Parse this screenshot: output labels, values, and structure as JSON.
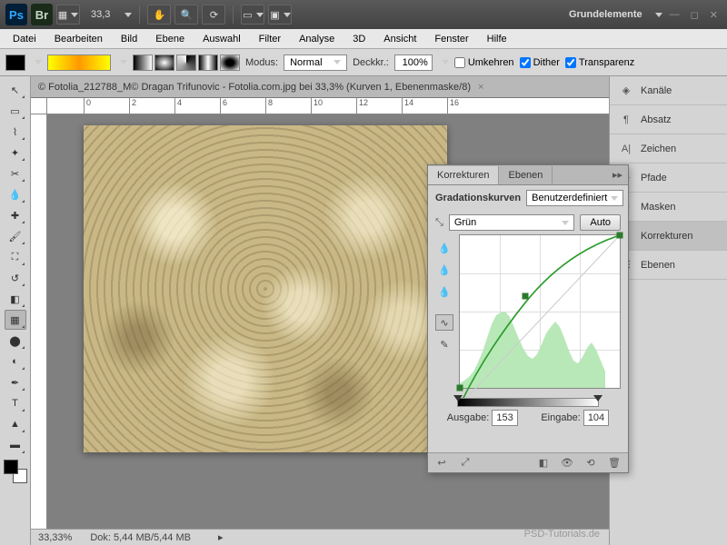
{
  "topbar": {
    "zoom": "33,3",
    "workspace_label": "Grundelemente"
  },
  "menu": [
    "Datei",
    "Bearbeiten",
    "Bild",
    "Ebene",
    "Auswahl",
    "Filter",
    "Analyse",
    "3D",
    "Ansicht",
    "Fenster",
    "Hilfe"
  ],
  "optbar": {
    "modus_label": "Modus:",
    "modus_value": "Normal",
    "deckkr_label": "Deckkr.:",
    "deckkr_value": "100%",
    "umkehren": "Umkehren",
    "dither": "Dither",
    "transparenz": "Transparenz"
  },
  "doc_tab": "© Fotolia_212788_M© Dragan Trifunovic - Fotolia.com.jpg bei 33,3% (Kurven 1, Ebenenmaske/8)",
  "ruler": [
    "0",
    "2",
    "4",
    "6",
    "8",
    "10",
    "12",
    "14",
    "16"
  ],
  "status": {
    "zoom": "33,33%",
    "doc": "Dok: 5,44 MB/5,44 MB"
  },
  "right_panels": [
    {
      "key": "kanaele",
      "label": "Kanäle"
    },
    {
      "key": "absatz",
      "label": "Absatz"
    },
    {
      "key": "zeichen",
      "label": "Zeichen"
    },
    {
      "key": "pfade",
      "label": "Pfade"
    },
    {
      "key": "masken",
      "label": "Masken"
    },
    {
      "key": "korrekturen",
      "label": "Korrekturen"
    },
    {
      "key": "ebenen",
      "label": "Ebenen"
    }
  ],
  "korrekturen": {
    "tab1": "Korrekturen",
    "tab2": "Ebenen",
    "title": "Gradationskurven",
    "preset": "Benutzerdefiniert",
    "channel": "Grün",
    "auto": "Auto",
    "ausgabe_label": "Ausgabe:",
    "ausgabe": "153",
    "eingabe_label": "Eingabe:",
    "eingabe": "104"
  },
  "chart_data": {
    "type": "line",
    "title": "Gradationskurven",
    "xlabel": "Eingabe",
    "ylabel": "Ausgabe",
    "xlim": [
      0,
      255
    ],
    "ylim": [
      0,
      255
    ],
    "series": [
      {
        "name": "Grün",
        "values": [
          [
            0,
            0
          ],
          [
            40,
            78
          ],
          [
            104,
            153
          ],
          [
            180,
            215
          ],
          [
            255,
            255
          ]
        ]
      }
    ],
    "histogram": [
      5,
      8,
      12,
      18,
      28,
      40,
      55,
      70,
      86,
      96,
      98,
      92,
      80,
      66,
      54,
      46,
      42,
      48,
      60,
      72,
      78,
      70,
      56,
      40,
      30,
      26,
      34,
      44,
      50,
      42,
      30,
      18
    ],
    "selected_point": {
      "eingabe": 104,
      "ausgabe": 153
    }
  },
  "watermark": "PSD-Tutorials.de"
}
